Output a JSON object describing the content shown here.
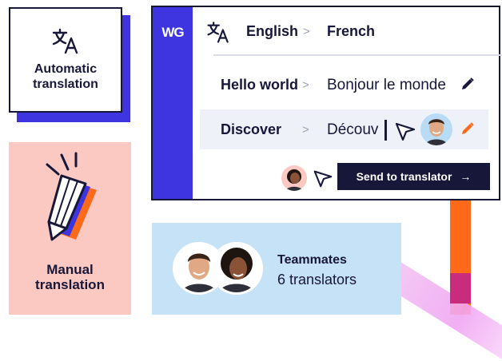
{
  "colors": {
    "brand_blue": "#3e34e0",
    "navy": "#17173a",
    "orange": "#ff6a1a",
    "salmon": "#fbc9c1",
    "light_blue": "#c6e2f6"
  },
  "auto_card": {
    "label": "Automatic\ntranslation",
    "icon": "translate-icon"
  },
  "manual_card": {
    "label": "Manual\ntranslation",
    "icon": "pencil-illustration"
  },
  "panel": {
    "logo": "WG",
    "languages": {
      "from": "English",
      "to": "French",
      "icon": "translate-icon"
    },
    "rows": [
      {
        "source": "Hello world",
        "target": "Bonjour le monde",
        "icon": "pencil-icon"
      },
      {
        "source": "Discover",
        "target": "Découv",
        "icon": "pencil-icon"
      }
    ],
    "send_label": "Send to translator"
  },
  "teammates": {
    "title": "Teammates",
    "subtitle": "6 translators"
  }
}
